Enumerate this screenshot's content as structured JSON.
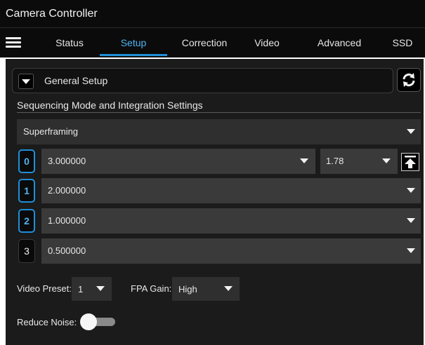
{
  "window": {
    "title": "Camera Controller"
  },
  "nav": {
    "tabs": [
      {
        "label": "Status"
      },
      {
        "label": "Setup",
        "active": true
      },
      {
        "label": "Correction"
      },
      {
        "label": "Video"
      },
      {
        "label": "Advanced"
      },
      {
        "label": "SSD"
      }
    ]
  },
  "setup": {
    "page_select": "General Setup",
    "section_title": "Sequencing Mode and Integration Settings",
    "mode": "Superframing",
    "rows": [
      {
        "index": "0",
        "value": "3.000000",
        "highlighted": true
      },
      {
        "index": "1",
        "value": "2.000000",
        "highlighted": true
      },
      {
        "index": "2",
        "value": "1.000000",
        "highlighted": true
      },
      {
        "index": "3",
        "value": "0.500000",
        "highlighted": false
      }
    ],
    "row0_extra": "1.78",
    "video_preset_label": "Video Preset:",
    "video_preset_value": "1",
    "fpa_gain_label": "FPA Gain:",
    "fpa_gain_value": "High",
    "reduce_noise_label": "Reduce Noise:",
    "reduce_noise_on": false
  },
  "colors": {
    "accent": "#1f8fd8",
    "panel": "#1b1b1b",
    "field": "#3a3a3a"
  }
}
